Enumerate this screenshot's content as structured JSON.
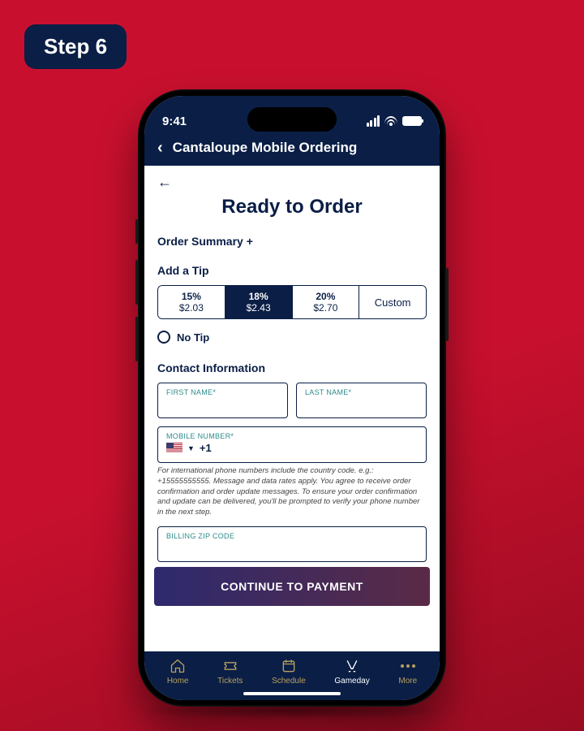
{
  "step_badge": "Step 6",
  "statusbar": {
    "time": "9:41"
  },
  "header": {
    "title": "Cantaloupe Mobile Ordering"
  },
  "page": {
    "title": "Ready to Order",
    "order_summary_label": "Order Summary +",
    "tip_heading": "Add a Tip",
    "tips": [
      {
        "pct": "15%",
        "amt": "$2.03",
        "selected": false
      },
      {
        "pct": "18%",
        "amt": "$2.43",
        "selected": true
      },
      {
        "pct": "20%",
        "amt": "$2.70",
        "selected": false
      }
    ],
    "tip_custom": "Custom",
    "no_tip": "No Tip",
    "contact_heading": "Contact Information",
    "first_name_label": "FIRST NAME*",
    "last_name_label": "LAST NAME*",
    "mobile_label": "MOBILE NUMBER*",
    "dial_code": "+1",
    "helper_text": "For international phone numbers include the country code. e.g.: +15555555555. Message and data rates apply. You agree to receive order confirmation and order update messages. To ensure your order confirmation and update can be delivered, you'll be prompted to verify your phone number in the next step.",
    "zip_label": "BILLING ZIP CODE",
    "cta": "CONTINUE TO PAYMENT"
  },
  "nav": {
    "items": [
      {
        "label": "Home"
      },
      {
        "label": "Tickets"
      },
      {
        "label": "Schedule"
      },
      {
        "label": "Gameday"
      },
      {
        "label": "More"
      }
    ]
  }
}
